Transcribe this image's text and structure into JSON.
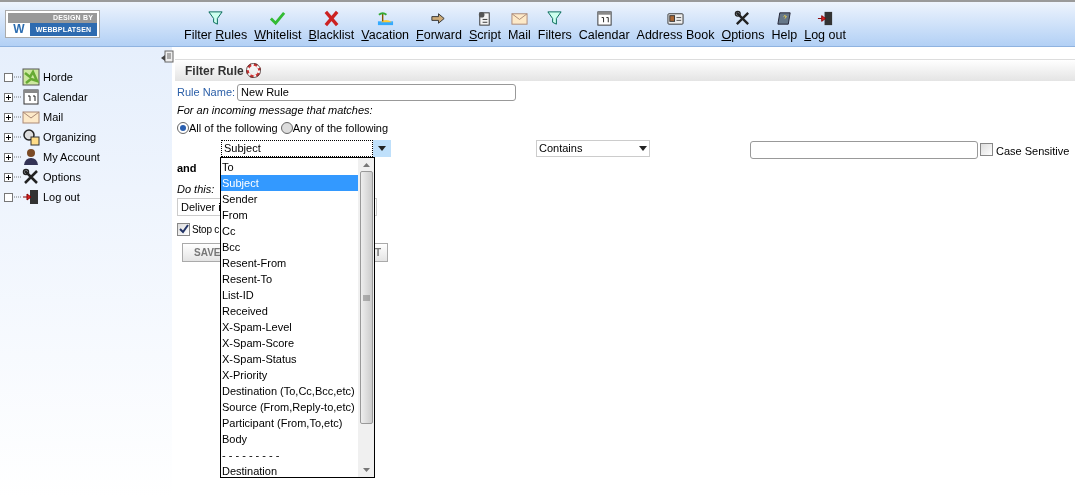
{
  "logo": {
    "top": "DESIGN BY",
    "letter": "W",
    "name": "WEBBPLATSEN"
  },
  "toolbar": [
    {
      "parts": [
        {
          "text": "Filter ",
          "underlined": false
        },
        {
          "text": "R",
          "underlined": true
        },
        {
          "text": "ules",
          "underlined": false
        }
      ]
    },
    {
      "parts": [
        {
          "text": "W",
          "underlined": true
        },
        {
          "text": "hitelist",
          "underlined": false
        }
      ]
    },
    {
      "parts": [
        {
          "text": "B",
          "underlined": true
        },
        {
          "text": "lacklist",
          "underlined": false
        }
      ]
    },
    {
      "parts": [
        {
          "text": "V",
          "underlined": true
        },
        {
          "text": "acation",
          "underlined": false
        }
      ]
    },
    {
      "parts": [
        {
          "text": "F",
          "underlined": true
        },
        {
          "text": "orward",
          "underlined": false
        }
      ]
    },
    {
      "parts": [
        {
          "text": "S",
          "underlined": true
        },
        {
          "text": "cript",
          "underlined": false
        }
      ]
    },
    {
      "parts": [
        {
          "text": "Mail",
          "underlined": false
        }
      ]
    },
    {
      "parts": [
        {
          "text": "Filters",
          "underlined": false
        }
      ]
    },
    {
      "parts": [
        {
          "text": "Calendar",
          "underlined": false
        }
      ]
    },
    {
      "parts": [
        {
          "text": "Address Book",
          "underlined": false
        }
      ]
    },
    {
      "parts": [
        {
          "text": "O",
          "underlined": true
        },
        {
          "text": "ptions",
          "underlined": false
        }
      ]
    },
    {
      "parts": [
        {
          "text": "Help",
          "underlined": false
        }
      ]
    },
    {
      "parts": [
        {
          "text": "L",
          "underlined": true
        },
        {
          "text": "og out",
          "underlined": false
        }
      ]
    }
  ],
  "sidebar": {
    "items": [
      {
        "label": "Horde",
        "expandable": false
      },
      {
        "label": "Calendar",
        "expandable": true
      },
      {
        "label": "Mail",
        "expandable": true
      },
      {
        "label": "Organizing",
        "expandable": true
      },
      {
        "label": "My Account",
        "expandable": true
      },
      {
        "label": "Options",
        "expandable": true
      },
      {
        "label": "Log out",
        "expandable": false
      }
    ]
  },
  "form": {
    "title": "Filter Rule",
    "rule_name": {
      "label": "Rule Name:",
      "value": "New Rule"
    },
    "match_prompt": "For an incoming message that matches:",
    "match_options": [
      {
        "label": "All of the following",
        "selected": true
      },
      {
        "label": "Any of the following",
        "selected": false
      }
    ],
    "field_select": {
      "value": "Subject",
      "expanded": true
    },
    "operator_select": {
      "value": "Contains"
    },
    "case_sensitive": {
      "label": "Case Sensitive",
      "checked": false
    },
    "conjunction": "and",
    "action_prompt": "Do this:",
    "action_select": {
      "value": "Deliver i"
    },
    "stop": {
      "label": "Stop c",
      "checked": true
    },
    "buttons": [
      "SAVE",
      "T"
    ]
  },
  "dropdown": {
    "options": [
      {
        "label": "To",
        "selected": false
      },
      {
        "label": "Subject",
        "selected": true
      },
      {
        "label": "Sender",
        "selected": false
      },
      {
        "label": "From",
        "selected": false
      },
      {
        "label": "Cc",
        "selected": false
      },
      {
        "label": "Bcc",
        "selected": false
      },
      {
        "label": "Resent-From",
        "selected": false
      },
      {
        "label": "Resent-To",
        "selected": false
      },
      {
        "label": "List-ID",
        "selected": false
      },
      {
        "label": "Received",
        "selected": false
      },
      {
        "label": "X-Spam-Level",
        "selected": false
      },
      {
        "label": "X-Spam-Score",
        "selected": false
      },
      {
        "label": "X-Spam-Status",
        "selected": false
      },
      {
        "label": "X-Priority",
        "selected": false
      },
      {
        "label": "Destination (To,Cc,Bcc,etc)",
        "selected": false
      },
      {
        "label": "Source (From,Reply-to,etc)",
        "selected": false
      },
      {
        "label": "Participant (From,To,etc)",
        "selected": false
      },
      {
        "label": "Body",
        "selected": false
      },
      {
        "label": "- - - - - - - - -",
        "selected": false
      },
      {
        "label": "Destination",
        "selected": false
      }
    ]
  }
}
